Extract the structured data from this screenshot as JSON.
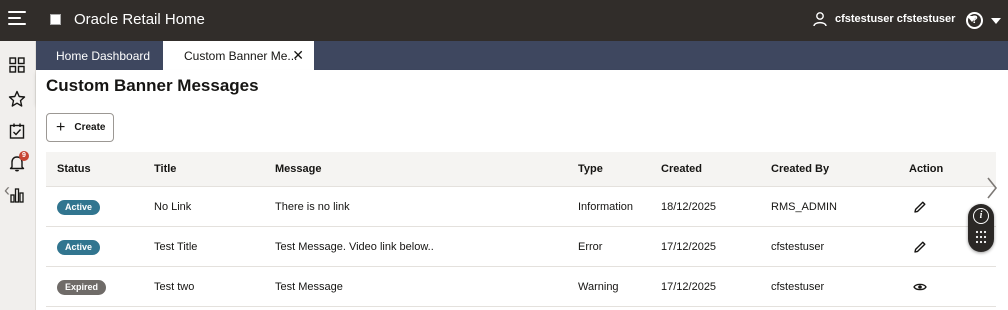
{
  "app": {
    "title": "Oracle Retail Home"
  },
  "header": {
    "user_name": "cfstestuser cfstestuser"
  },
  "sidebar": {
    "notification_count": "9",
    "items": [
      "dashboard-icon",
      "favorites-icon",
      "tasks-icon",
      "notifications-icon",
      "reports-icon"
    ]
  },
  "tabs": [
    {
      "label": "Home Dashboard"
    },
    {
      "label": "Custom Banner Me..."
    }
  ],
  "page": {
    "title": "Custom Banner Messages"
  },
  "toolbar": {
    "create_label": "Create"
  },
  "table": {
    "headers": [
      "Status",
      "Title",
      "Message",
      "Type",
      "Created",
      "Created By",
      "Action"
    ],
    "rows": [
      {
        "status": "Active",
        "title": "No Link",
        "message": "There is no link",
        "type": "Information",
        "created": "18/12/2025",
        "created_by": "RMS_ADMIN",
        "action": "edit-icon"
      },
      {
        "status": "Active",
        "title": "Test Title",
        "message": "Test Message. Video link below..",
        "type": "Error",
        "created": "17/12/2025",
        "created_by": "cfstestuser",
        "action": "edit-icon"
      },
      {
        "status": "Expired",
        "title": "Test two",
        "message": "Test Message",
        "type": "Warning",
        "created": "17/12/2025",
        "created_by": "cfstestuser",
        "action": "view-icon"
      }
    ]
  },
  "colors": {
    "topbar": "#312d2a",
    "tabbar": "#3e475f",
    "active_pill": "#31758f",
    "expired_pill": "#6f6b68",
    "badge": "#c74634"
  }
}
